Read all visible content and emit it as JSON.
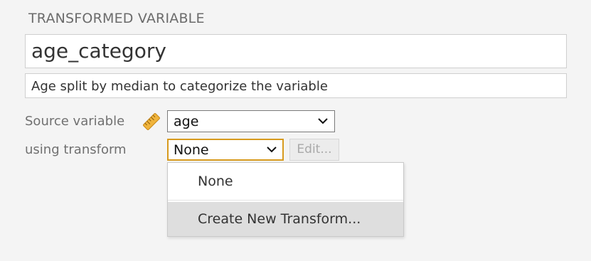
{
  "section": {
    "title": "TRANSFORMED VARIABLE"
  },
  "variable": {
    "name": "age_category",
    "description": "Age split by median to categorize the variable"
  },
  "source": {
    "label": "Source variable",
    "icon": "ruler-icon",
    "selected": "age"
  },
  "transform": {
    "label": "using transform",
    "selected": "None",
    "edit_label": "Edit..."
  },
  "dropdown": {
    "items": [
      {
        "label": "None"
      },
      {
        "label": "Create New Transform..."
      }
    ]
  },
  "colors": {
    "background": "#f4f4f4",
    "focus_border": "#d79a1e",
    "ruler": "#f0b43c",
    "hover_item": "#dedede"
  }
}
